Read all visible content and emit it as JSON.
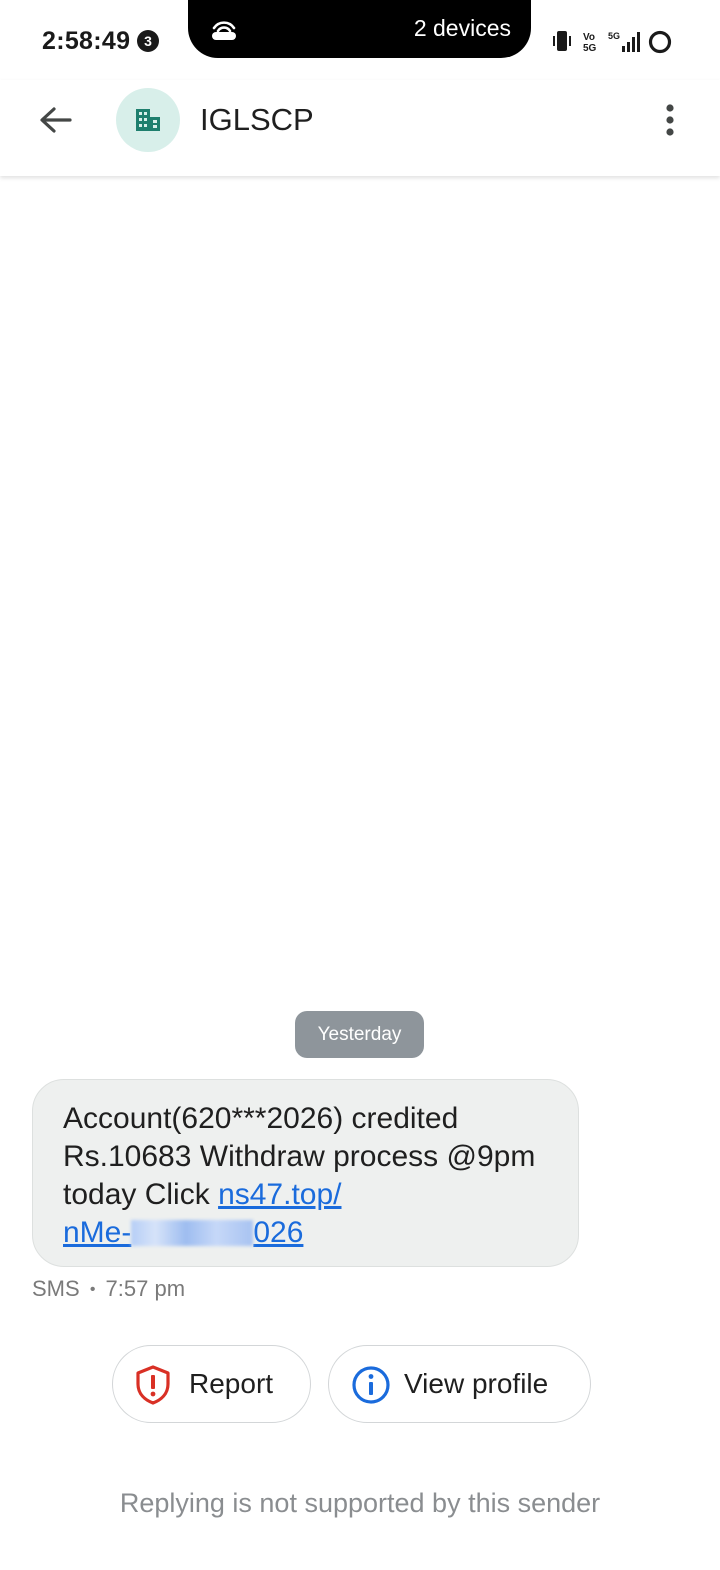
{
  "status_bar": {
    "time": "2:58:49",
    "notification_count": "3",
    "island_text": "2 devices",
    "icons": [
      "hotspot-icon",
      "vibrate-icon",
      "volte-icon",
      "5g-signal-icon",
      "battery-ring-icon"
    ],
    "volte_label_top": "Vo",
    "volte_label_bottom": "5G",
    "network_label": "5G"
  },
  "app_bar": {
    "contact_name": "IGLSCP",
    "avatar_icon": "business-building-icon",
    "avatar_bg": "#d8efea",
    "avatar_icon_color": "#1e7f6e"
  },
  "conversation": {
    "date_chip": "Yesterday",
    "message": {
      "text": "Account(620***2026) credited Rs.10683 Withdraw process @9pm today Click ",
      "link_part1": "ns47.top/",
      "link_part2_start": "nMe-",
      "link_part2_end": "026",
      "link_color": "#1a6bdc"
    },
    "meta": {
      "channel": "SMS",
      "separator": "•",
      "time": "7:57 pm"
    }
  },
  "actions": {
    "report_label": "Report",
    "view_profile_label": "View profile",
    "report_color": "#d93025",
    "view_profile_color": "#1a6bdc"
  },
  "footer": {
    "reply_note": "Replying is not supported by this sender"
  }
}
